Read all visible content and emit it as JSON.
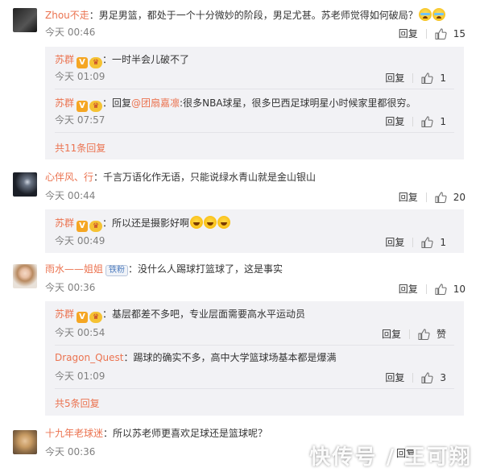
{
  "comments": [
    {
      "user": "Zhou不走",
      "text": "：男足男篮，都处于一个十分微妙的阶段，男足尤甚。苏老师觉得如何破局？",
      "time": "今天 00:46",
      "reply_label": "回复",
      "likes": "15",
      "emojis": [
        "cry-laugh-emoji",
        "cry-laugh-emoji"
      ],
      "sub_replies": [
        {
          "user": "苏群",
          "text": "：一时半会儿破不了",
          "time": "今天 01:09",
          "reply_label": "回复",
          "likes": "1"
        },
        {
          "user": "苏群",
          "prefix": "：回复",
          "mention": "@团扇嘉凛",
          "text": ":很多NBA球星，很多巴西足球明星小时候家里都很穷。",
          "time": "今天 07:57",
          "reply_label": "回复",
          "likes": "1"
        }
      ],
      "more": "共11条回复"
    },
    {
      "user": "心伴风、行",
      "text": "：千言万语化作无语，只能说绿水青山就是金山银山",
      "time": "今天 00:44",
      "reply_label": "回复",
      "likes": "20",
      "sub_replies": [
        {
          "user": "苏群",
          "text": "：所以还是摄影好啊",
          "time": "今天 00:49",
          "reply_label": "回复",
          "likes": "1"
        }
      ]
    },
    {
      "user": "雨水——姐姐",
      "badge": "铁粉",
      "text": "：没什么人踢球打篮球了，这是事实",
      "time": "今天 00:36",
      "reply_label": "回复",
      "likes": "10",
      "sub_replies": [
        {
          "user": "苏群",
          "text": "：基层都差不多吧，专业层面需要高水平运动员",
          "time": "今天 00:54",
          "reply_label": "回复",
          "likes": "赞"
        },
        {
          "user": "Dragon_Quest",
          "text": "：踢球的确实不多，高中大学篮球场基本都是爆满",
          "time": "今天 01:09",
          "reply_label": "回复",
          "likes": "3"
        }
      ],
      "more": "共5条回复"
    },
    {
      "user": "十九年老球迷",
      "text": "：所以苏老师更喜欢足球还是篮球呢？",
      "time": "今天 00:36",
      "reply_label": "回复",
      "likes": ""
    }
  ],
  "badges": {
    "verified": "V",
    "level": "♛"
  },
  "watermark": "快传号 / 王可翔",
  "colors": {
    "accent": "#eb7350",
    "subbox": "#f2f2f5",
    "muted": "#808080"
  }
}
